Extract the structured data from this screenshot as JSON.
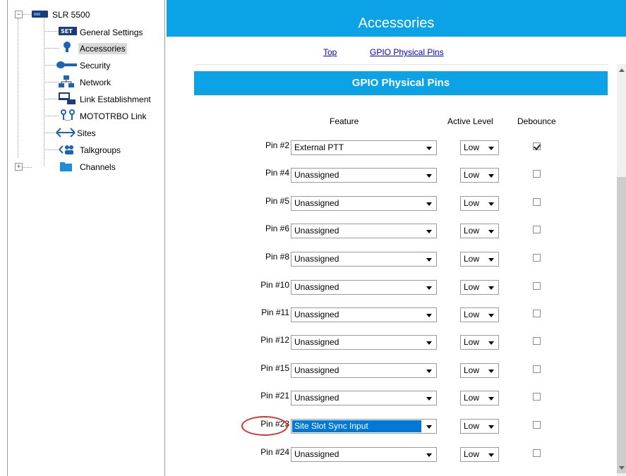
{
  "tree": {
    "root": {
      "label": "SLR 5500",
      "expander": "−"
    },
    "items": [
      {
        "label": "General Settings",
        "icon": "settings-icon"
      },
      {
        "label": "Accessories",
        "icon": "accessory-icon",
        "selected": true
      },
      {
        "label": "Security",
        "icon": "key-icon"
      },
      {
        "label": "Network",
        "icon": "network-icon"
      },
      {
        "label": "Link Establishment",
        "icon": "link-establishment-icon"
      },
      {
        "label": "MOTOTRBO Link",
        "icon": "mototrbo-link-icon"
      },
      {
        "label": "Sites",
        "icon": "sites-icon"
      },
      {
        "label": "Talkgroups",
        "icon": "talkgroups-icon"
      },
      {
        "label": "Channels",
        "icon": "folder-icon",
        "expander": "+"
      }
    ]
  },
  "main": {
    "title": "Accessories",
    "links": {
      "top": "Top",
      "gpio": "GPIO Physical Pins"
    },
    "section_title": "GPIO Physical Pins",
    "columns": {
      "feature": "Feature",
      "active_level": "Active Level",
      "debounce": "Debounce"
    },
    "pins": [
      {
        "pin": "Pin #2",
        "feature": "External PTT",
        "level": "Low",
        "debounce": true
      },
      {
        "pin": "Pin #4",
        "feature": "Unassigned",
        "level": "Low",
        "debounce": false
      },
      {
        "pin": "Pin #5",
        "feature": "Unassigned",
        "level": "Low",
        "debounce": false
      },
      {
        "pin": "Pin #6",
        "feature": "Unassigned",
        "level": "Low",
        "debounce": false
      },
      {
        "pin": "Pin #8",
        "feature": "Unassigned",
        "level": "Low",
        "debounce": false
      },
      {
        "pin": "Pin #10",
        "feature": "Unassigned",
        "level": "Low",
        "debounce": false
      },
      {
        "pin": "Pin #11",
        "feature": "Unassigned",
        "level": "Low",
        "debounce": false
      },
      {
        "pin": "Pin #12",
        "feature": "Unassigned",
        "level": "Low",
        "debounce": false
      },
      {
        "pin": "Pin #15",
        "feature": "Unassigned",
        "level": "Low",
        "debounce": false
      },
      {
        "pin": "Pin #21",
        "feature": "Unassigned",
        "level": "Low",
        "debounce": false
      },
      {
        "pin": "Pin #23",
        "feature": "Site Slot Sync Input",
        "level": "Low",
        "debounce": false,
        "selected": true,
        "highlighted": true
      },
      {
        "pin": "Pin #24",
        "feature": "Unassigned",
        "level": "Low",
        "debounce": false
      }
    ]
  },
  "colors": {
    "banner": "#0ba3e6",
    "link": "#0000cc",
    "selection": "#0078d7",
    "highlight_circle": "#d9302c"
  }
}
